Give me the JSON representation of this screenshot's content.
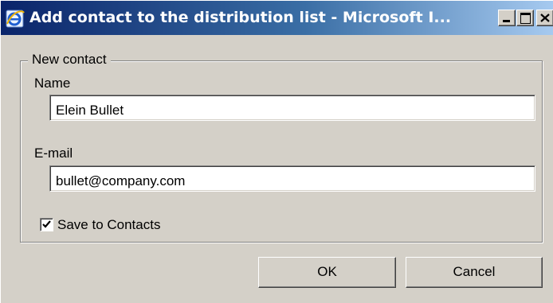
{
  "window": {
    "title": "Add contact to the distribution list - Microsoft I...",
    "icon": "internet-explorer-icon",
    "controls": {
      "minimize_icon": "minimize-icon",
      "maximize_icon": "maximize-icon",
      "close_icon": "close-icon"
    },
    "colors": {
      "titlebar_start": "#0a246a",
      "titlebar_end": "#a6caf0",
      "face": "#d4d0c8"
    }
  },
  "form": {
    "group_label": "New contact",
    "name_label": "Name",
    "name_value": "Elein Bullet",
    "email_label": "E-mail",
    "email_value": "bullet@company.com",
    "save_contacts_label": "Save to Contacts",
    "save_contacts_checked": true
  },
  "buttons": {
    "ok_label": "OK",
    "cancel_label": "Cancel"
  }
}
